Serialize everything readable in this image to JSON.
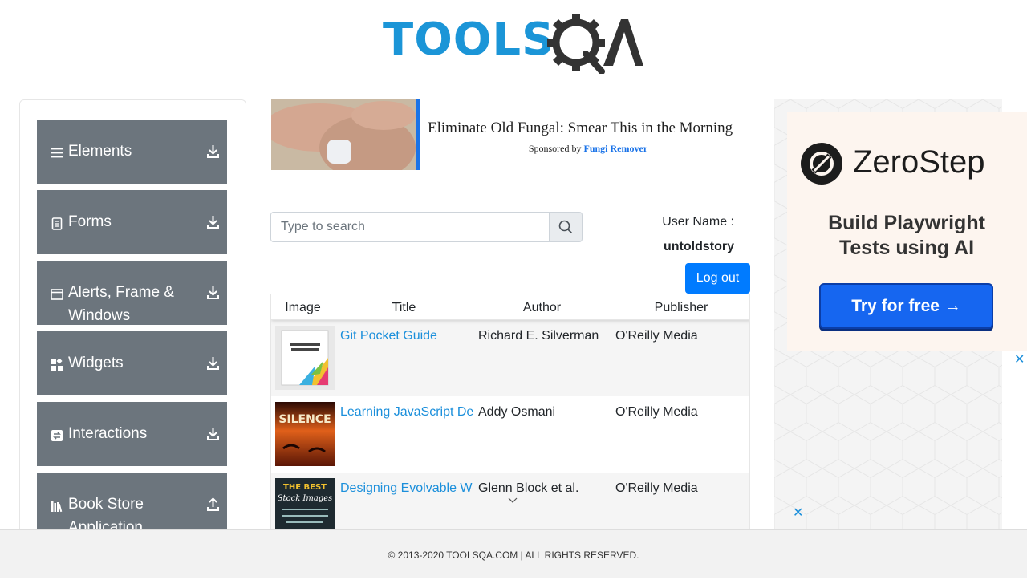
{
  "logo": {
    "text_main": "TOOLS",
    "text_qa": "QA"
  },
  "sidebar": {
    "groups": [
      {
        "label": "Elements",
        "icon": "hamburger-icon",
        "arrow": "download-icon"
      },
      {
        "label": "Forms",
        "icon": "document-icon",
        "arrow": "download-icon"
      },
      {
        "label": "Alerts, Frame & Windows",
        "icon": "window-icon",
        "arrow": "download-icon"
      },
      {
        "label": "Widgets",
        "icon": "widgets-icon",
        "arrow": "download-icon"
      },
      {
        "label": "Interactions",
        "icon": "interactions-icon",
        "arrow": "download-icon"
      },
      {
        "label": "Book Store Application",
        "icon": "books-icon",
        "arrow": "upload-icon"
      }
    ]
  },
  "ad_top": {
    "title": "Eliminate Old Fungal: Smear This in the Morning",
    "sponsored_prefix": "Sponsored by",
    "sponsor": "Fungi Remover"
  },
  "search": {
    "placeholder": "Type to search",
    "value": ""
  },
  "user": {
    "label": "User Name :",
    "name": "untoldstory",
    "logout_label": "Log out"
  },
  "table": {
    "headers": [
      "Image",
      "Title",
      "Author",
      "Publisher"
    ],
    "rows": [
      {
        "title": "Git Pocket Guide",
        "author": "Richard E. Silverman",
        "publisher": "O'Reilly Media",
        "image": "business-design-cover"
      },
      {
        "title": "Learning JavaScript Design Patterns",
        "author": "Addy Osmani",
        "publisher": "O'Reilly Media",
        "image": "silence-cover"
      },
      {
        "title": "Designing Evolvable Web APIs with ASP.NET",
        "author": "Glenn Block et al.",
        "publisher": "O'Reilly Media",
        "image": "stock-images-cover"
      }
    ]
  },
  "ad_right": {
    "brand": "ZeroStep",
    "tagline": "Build Playwright Tests using AI",
    "cta": "Try for free →",
    "close": "✕"
  },
  "footer": {
    "text": "© 2013-2020 TOOLSQA.COM | ALL RIGHTS RESERVED."
  },
  "colors": {
    "accent": "#007bff",
    "sidebar_bg": "#6c757d",
    "link": "#1b8fdb",
    "logo_blue": "#1b95d7"
  }
}
